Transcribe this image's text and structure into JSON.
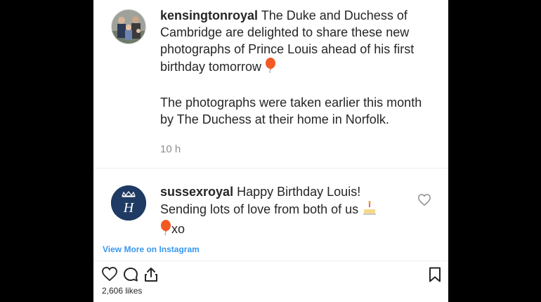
{
  "posts": {
    "kensington": {
      "username": "kensingtonroyal",
      "text_1": "The Duke and Duchess of Cambridge are delighted to share these new photographs of Prince Louis ahead of his first birthday tomorrow",
      "emoji_1": "balloon",
      "text_2": "The photographs were taken earlier this month by The Duchess at their home in Norfolk.",
      "timestamp": "10 h"
    },
    "sussex": {
      "username": "sussexroyal",
      "text_1": "Happy Birthday Louis! Sending lots of love from both of us",
      "emoji_1": "birthday-cake",
      "emoji_2": "balloon",
      "text_2": "xo"
    }
  },
  "footer": {
    "view_more": "View More on Instagram",
    "likes": "2,606 likes"
  },
  "icons": [
    "heart-icon",
    "comment-icon",
    "share-icon",
    "bookmark-icon"
  ],
  "colors": {
    "background": "#000000",
    "card": "#ffffff",
    "text": "#262626",
    "muted": "#8e8e8e",
    "link": "#3897f0",
    "balloon": "#f15a24",
    "sussex_avatar": "#1f3a63"
  }
}
